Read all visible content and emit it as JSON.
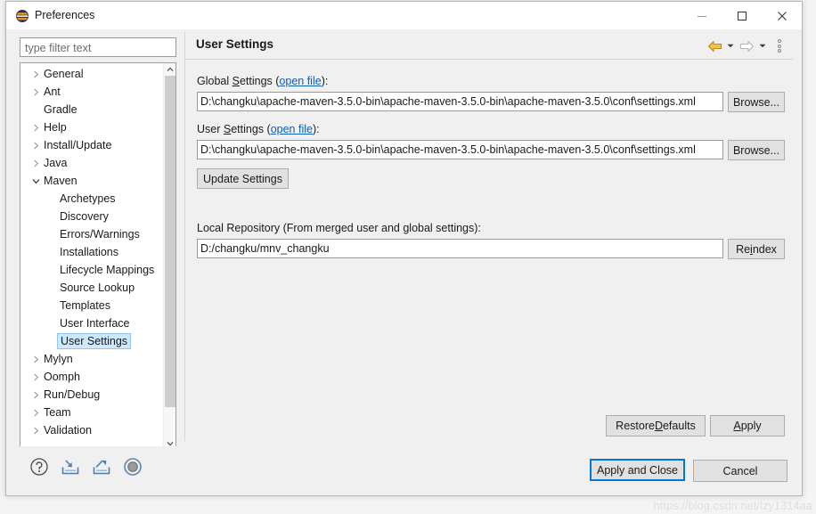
{
  "window": {
    "title": "Preferences",
    "icon": "eclipse-logo-icon",
    "minimize_label": "–",
    "maximize_label": "□",
    "close_label": "✕"
  },
  "filter": {
    "placeholder": "type filter text",
    "value": ""
  },
  "tree": {
    "items": [
      {
        "label": "General",
        "level": 0,
        "expandable": true,
        "expanded": false,
        "selected": false
      },
      {
        "label": "Ant",
        "level": 0,
        "expandable": true,
        "expanded": false,
        "selected": false
      },
      {
        "label": "Gradle",
        "level": 0,
        "expandable": false,
        "expanded": false,
        "selected": false
      },
      {
        "label": "Help",
        "level": 0,
        "expandable": true,
        "expanded": false,
        "selected": false
      },
      {
        "label": "Install/Update",
        "level": 0,
        "expandable": true,
        "expanded": false,
        "selected": false
      },
      {
        "label": "Java",
        "level": 0,
        "expandable": true,
        "expanded": false,
        "selected": false
      },
      {
        "label": "Maven",
        "level": 0,
        "expandable": true,
        "expanded": true,
        "selected": false
      },
      {
        "label": "Archetypes",
        "level": 1,
        "expandable": false,
        "expanded": false,
        "selected": false
      },
      {
        "label": "Discovery",
        "level": 1,
        "expandable": false,
        "expanded": false,
        "selected": false
      },
      {
        "label": "Errors/Warnings",
        "level": 1,
        "expandable": false,
        "expanded": false,
        "selected": false
      },
      {
        "label": "Installations",
        "level": 1,
        "expandable": false,
        "expanded": false,
        "selected": false
      },
      {
        "label": "Lifecycle Mappings",
        "level": 1,
        "expandable": false,
        "expanded": false,
        "selected": false
      },
      {
        "label": "Source Lookup",
        "level": 1,
        "expandable": false,
        "expanded": false,
        "selected": false
      },
      {
        "label": "Templates",
        "level": 1,
        "expandable": false,
        "expanded": false,
        "selected": false
      },
      {
        "label": "User Interface",
        "level": 1,
        "expandable": false,
        "expanded": false,
        "selected": false
      },
      {
        "label": "User Settings",
        "level": 1,
        "expandable": false,
        "expanded": false,
        "selected": true
      },
      {
        "label": "Mylyn",
        "level": 0,
        "expandable": true,
        "expanded": false,
        "selected": false
      },
      {
        "label": "Oomph",
        "level": 0,
        "expandable": true,
        "expanded": false,
        "selected": false
      },
      {
        "label": "Run/Debug",
        "level": 0,
        "expandable": true,
        "expanded": false,
        "selected": false
      },
      {
        "label": "Team",
        "level": 0,
        "expandable": true,
        "expanded": false,
        "selected": false
      },
      {
        "label": "Validation",
        "level": 0,
        "expandable": true,
        "expanded": false,
        "selected": false
      }
    ],
    "scroll_up_glyph": "⌃",
    "scroll_down_glyph": "⌄",
    "scroll_left_glyph": "‹",
    "scroll_right_glyph": "›"
  },
  "page": {
    "title": "User Settings",
    "nav": {
      "back_icon": "back-arrow-icon",
      "back_caret": "▾",
      "forward_icon": "forward-arrow-icon",
      "forward_caret": "▾",
      "menu_icon": "view-menu-icon"
    },
    "global_settings": {
      "label_pre": "Global ",
      "label_mnemonic": "S",
      "label_post": "ettings (",
      "link": "open file",
      "label_tail": "):",
      "value": "D:\\changku\\apache-maven-3.5.0-bin\\apache-maven-3.5.0-bin\\apache-maven-3.5.0\\conf\\settings.xml",
      "browse_label": "Browse..."
    },
    "user_settings": {
      "label_pre": "User ",
      "label_mnemonic": "S",
      "label_post": "ettings (",
      "link": "open file",
      "label_tail": "):",
      "value": "D:\\changku\\apache-maven-3.5.0-bin\\apache-maven-3.5.0-bin\\apache-maven-3.5.0\\conf\\settings.xml",
      "browse_label": "Browse..."
    },
    "update_settings_label": "Update Settings",
    "local_repository": {
      "label": "Local Repository (From merged user and global settings):",
      "value": "D:/changku/mnv_changku",
      "reindex_pre": "Re",
      "reindex_mnemonic": "i",
      "reindex_post": "ndex"
    },
    "restore_defaults": {
      "pre": "Restore ",
      "mnemonic": "D",
      "post": "efaults"
    },
    "apply": {
      "pre": "",
      "mnemonic": "A",
      "post": "pply"
    }
  },
  "footer": {
    "icons": [
      {
        "name": "help-icon",
        "title": "Help"
      },
      {
        "name": "import-preferences-icon",
        "title": "Import"
      },
      {
        "name": "export-preferences-icon",
        "title": "Export"
      },
      {
        "name": "oomph-record-icon",
        "title": "Record"
      }
    ],
    "apply_and_close": "Apply and Close",
    "cancel": "Cancel"
  },
  "watermark": "https://blog.csdn.net/lzy1314aa",
  "colors": {
    "accent": "#0078d7",
    "link": "#0f5fb0",
    "selection_bg": "#cde8ff",
    "selection_border": "#93c5f0",
    "button_face": "#e1e1e1",
    "dialog_bg": "#f0f0f0"
  }
}
